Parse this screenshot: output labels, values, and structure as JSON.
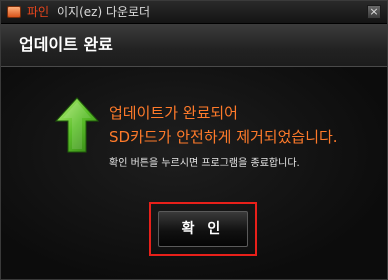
{
  "window": {
    "title_brand": "파인",
    "title_rest": "이지(ez) 다운로더",
    "close_label": "×"
  },
  "header": {
    "title": "업데이트 완료"
  },
  "message": {
    "line1": "업데이트가 완료되어",
    "line2": "SD카드가 안전하게 제거되었습니다.",
    "sub": "확인 버튼을 누르시면 프로그램을 종료합니다."
  },
  "buttons": {
    "confirm_label": "확 인"
  },
  "icons": {
    "app": "app-icon",
    "success_arrow": "green-up-arrow-icon",
    "close": "close-icon"
  },
  "colors": {
    "accent_orange": "#ff7a2a",
    "brand_red": "#e8451c",
    "highlight_red": "#e8201a",
    "arrow_green": "#6cc83a"
  }
}
